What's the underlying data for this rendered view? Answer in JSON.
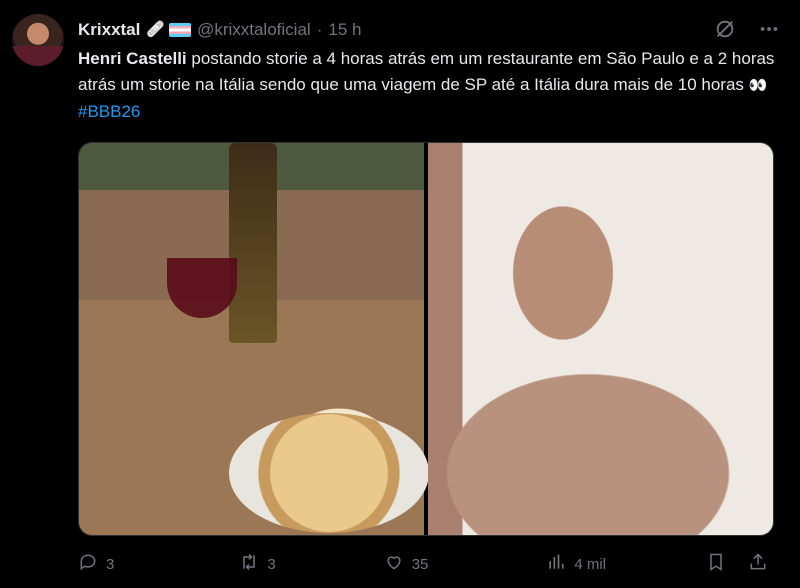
{
  "author": {
    "name": "Krixxtal",
    "badge_emoji": "🩹",
    "handle": "@krixxtaloficial",
    "separator": "·",
    "time": "15 h"
  },
  "tweet": {
    "mention_name": "Henri Castelli",
    "text": " postando storie a 4 horas atrás em um restaurante em São Paulo e a 2 horas atrás um storie na Itália sendo que uma viagem de SP até a Itália dura mais de 10 horas ",
    "eyes": "👀",
    "hashtag": "#BBB26"
  },
  "actions": {
    "replies": "3",
    "reposts": "3",
    "likes": "35",
    "views": "4 mil"
  },
  "icons": [
    "grok-slash-icon",
    "more-icon",
    "reply-icon",
    "repost-icon",
    "like-icon",
    "views-icon",
    "bookmark-icon",
    "share-icon"
  ],
  "colors": {
    "accent": "#1d9bf0",
    "muted": "#71767b",
    "text": "#e7e9ea",
    "background": "#000000"
  }
}
